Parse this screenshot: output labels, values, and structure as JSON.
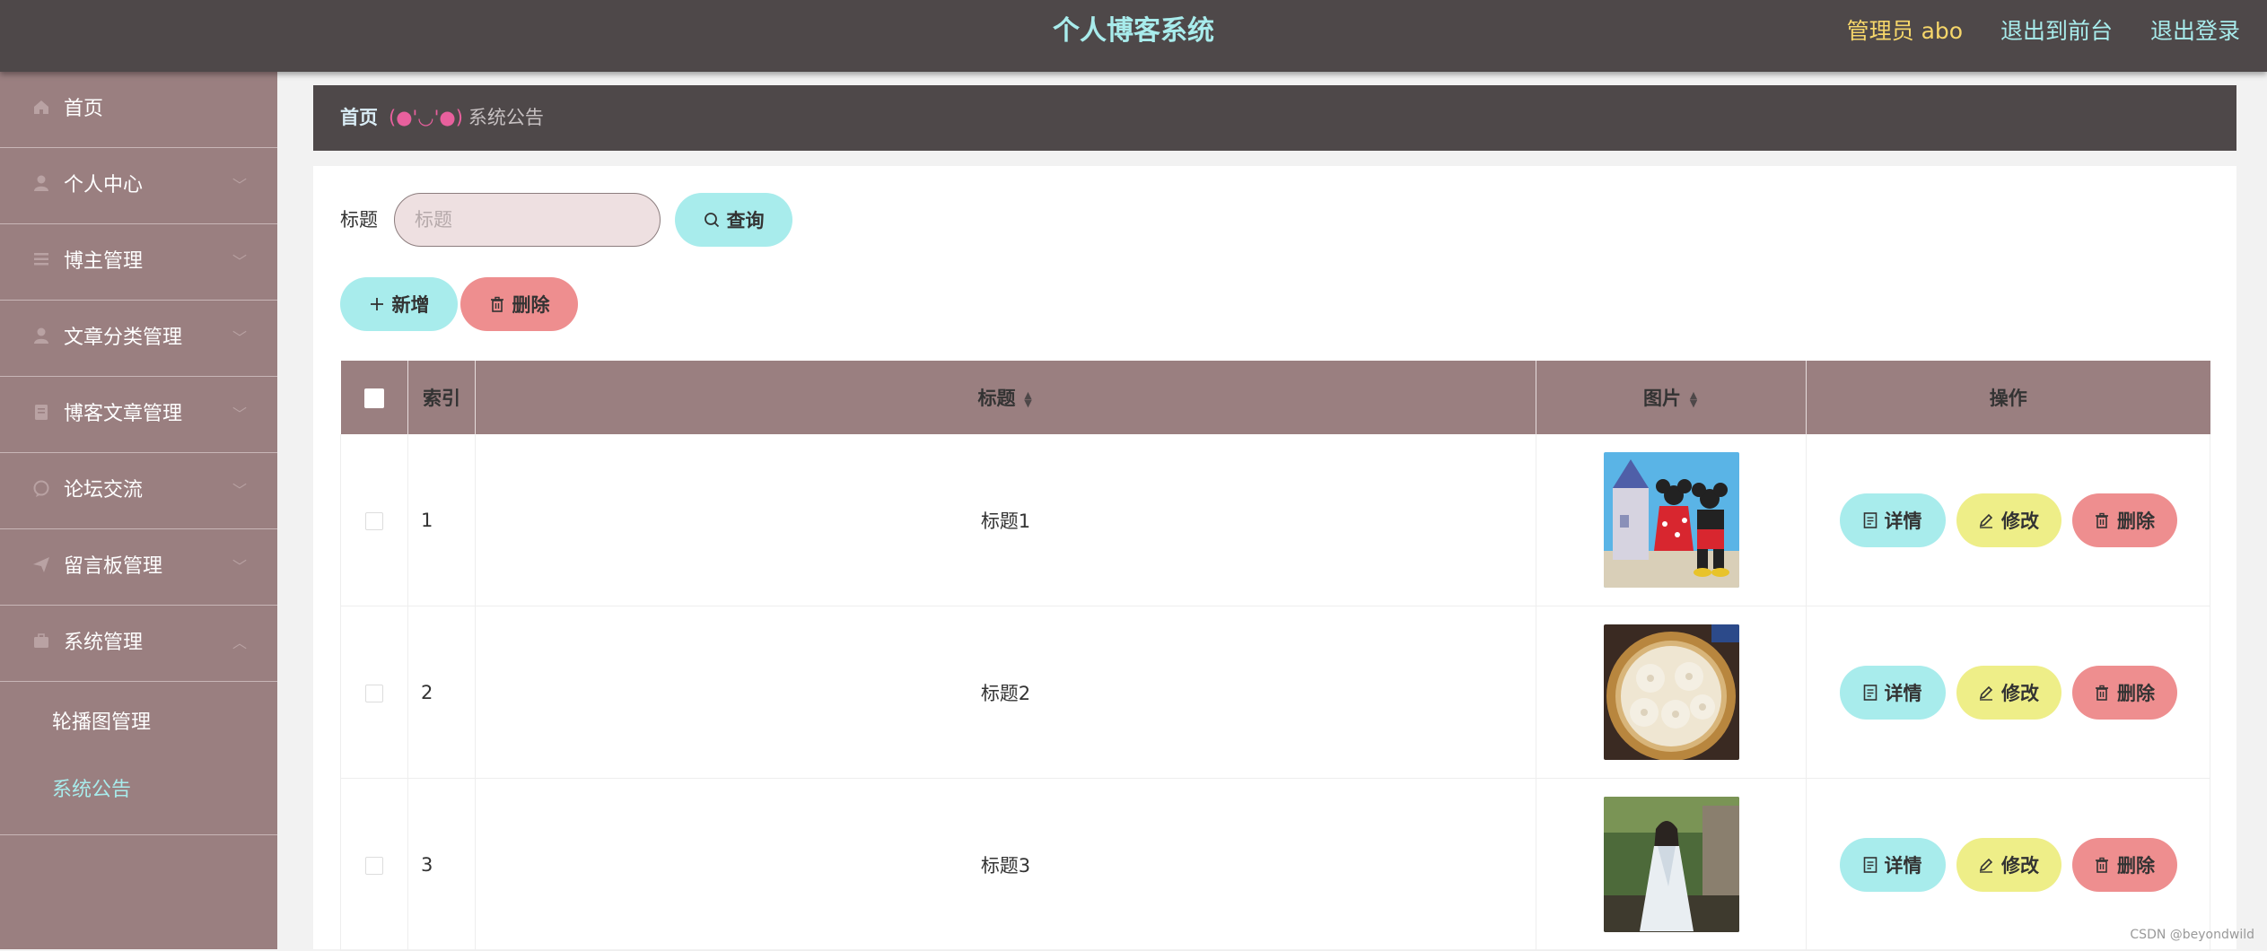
{
  "header": {
    "title": "个人博客系统",
    "admin_label": "管理员 abo",
    "back_to_front": "退出到前台",
    "logout": "退出登录"
  },
  "sidebar": {
    "items": [
      {
        "label": "首页",
        "icon": "home-icon"
      },
      {
        "label": "个人中心",
        "icon": "user-icon"
      },
      {
        "label": "博主管理",
        "icon": "list-icon"
      },
      {
        "label": "文章分类管理",
        "icon": "user-icon"
      },
      {
        "label": "博客文章管理",
        "icon": "document-icon"
      },
      {
        "label": "论坛交流",
        "icon": "chat-icon"
      },
      {
        "label": "留言板管理",
        "icon": "send-icon"
      },
      {
        "label": "系统管理",
        "icon": "briefcase-icon"
      }
    ],
    "submenu": [
      {
        "label": "轮播图管理"
      },
      {
        "label": "系统公告",
        "active": true
      }
    ]
  },
  "breadcrumb": {
    "home": "首页",
    "separator": "(●'◡'●)",
    "current": "系统公告"
  },
  "search": {
    "label": "标题",
    "placeholder": "标题",
    "value": "",
    "query_button": "查询"
  },
  "toolbar": {
    "add_button": "新增",
    "delete_button": "删除"
  },
  "table": {
    "columns": [
      "索引",
      "标题",
      "图片",
      "操作"
    ],
    "rows": [
      {
        "index": "1",
        "title": "标题1",
        "image": "mickey-minnie-castle-photo"
      },
      {
        "index": "2",
        "title": "标题2",
        "image": "dumplings-steamer-photo"
      },
      {
        "index": "3",
        "title": "标题3",
        "image": "girl-in-dress-photo"
      }
    ],
    "actions": {
      "detail": "详情",
      "edit": "修改",
      "delete": "删除"
    }
  },
  "watermark": "CSDN @beyondwild",
  "colors": {
    "topbar": "#4e4849",
    "accent_cyan": "#a8ecec",
    "accent_yellow": "#eeee88",
    "accent_red": "#ee8e8f",
    "sidebar": "#9a7f80",
    "admin_gold": "#f6d66a",
    "crumb_pink": "#e8609d"
  }
}
